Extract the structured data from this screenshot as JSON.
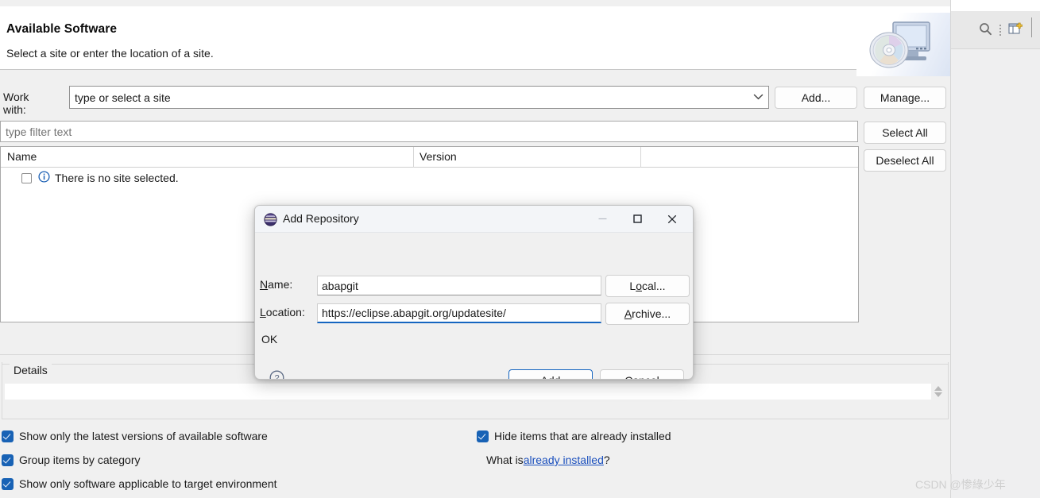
{
  "wizard": {
    "title": "Available Software",
    "subtitle": "Select a site or enter the location of a site.",
    "banner_icon": "monitor-with-disc-icon",
    "work_with": {
      "label": "Work with:",
      "value": "type or select a site",
      "arrow_icon": "chevron-down-icon"
    },
    "buttons": {
      "add": "Add...",
      "manage": "Manage...",
      "select_all": "Select All",
      "deselect_all": "Deselect All"
    },
    "filter": {
      "placeholder": "type filter text",
      "value": ""
    },
    "table": {
      "columns": [
        "Name",
        "Version"
      ],
      "rows": [
        {
          "checked": false,
          "icon": "info-circle-icon",
          "label": "There is no site selected.",
          "version": ""
        }
      ]
    },
    "details": {
      "label": "Details",
      "value": "",
      "spinner_icon": "scroll-spinner-icon"
    },
    "footer": {
      "left_options": [
        {
          "label": "Show only the latest versions of available software",
          "checked": true
        },
        {
          "label": "Group items by category",
          "checked": true
        },
        {
          "label": "Show only software applicable to target environment",
          "checked": true
        }
      ],
      "right_options": [
        {
          "label": "Hide items that are already installed",
          "checked": true
        }
      ],
      "what_is_prefix": "What is ",
      "what_is_link": "already installed",
      "what_is_suffix": "?"
    }
  },
  "toolbar": {
    "search_icon": "search-icon",
    "overflow_icon": "vertical-dots-icon",
    "new_perspective_icon": "new-perspective-icon"
  },
  "dialog": {
    "title": "Add Repository",
    "app_icon": "eclipse-logo-icon",
    "window_buttons": {
      "minimize": "minimize-icon",
      "maximize": "maximize-icon",
      "close": "close-icon"
    },
    "fields": {
      "name_label_pre": "N",
      "name_label_mnemonic": "",
      "name_label": "Name:",
      "name_value": "abapgit",
      "location_label": "Location:",
      "location_value": "https://eclipse.abapgit.org/updatesite/"
    },
    "buttons": {
      "local": "Local...",
      "archive": "Archive...",
      "add": "Add",
      "cancel": "Cancel"
    },
    "status": "OK",
    "help_icon": "help-circle-icon"
  },
  "watermark": {
    "text": "CSDN @惨綠少年"
  },
  "colors": {
    "accent": "#1565c0",
    "checkbox_on": "#1862b5",
    "link": "#1a4fbd",
    "info": "#1a5fb4"
  }
}
